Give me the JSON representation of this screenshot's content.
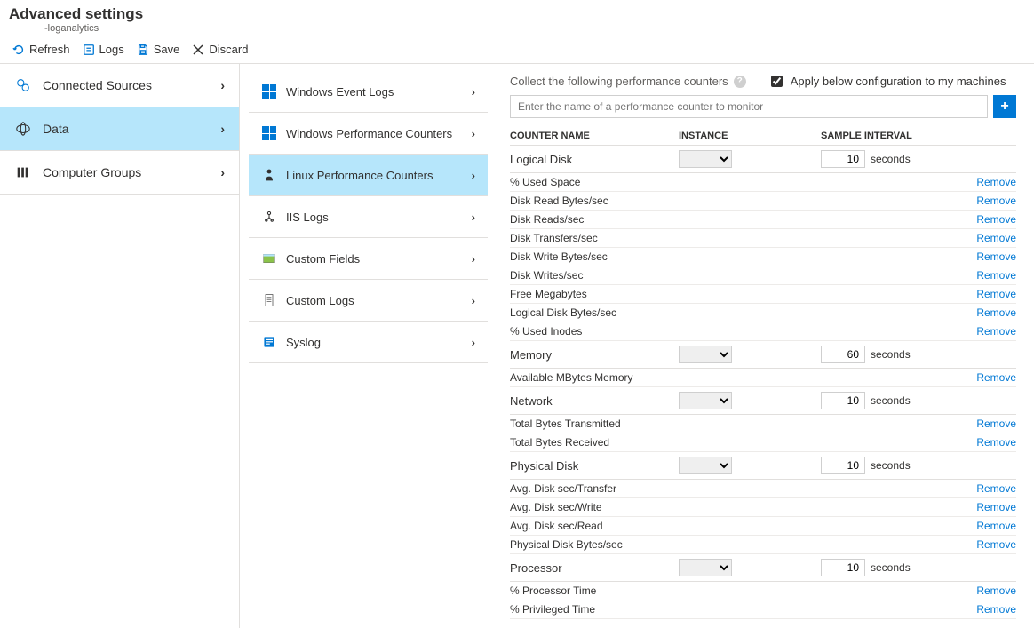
{
  "header": {
    "title": "Advanced settings",
    "subtitle": "-loganalytics"
  },
  "toolbar": {
    "refresh": "Refresh",
    "logs": "Logs",
    "save": "Save",
    "discard": "Discard"
  },
  "sidebar": [
    {
      "label": "Connected Sources",
      "selected": false
    },
    {
      "label": "Data",
      "selected": true
    },
    {
      "label": "Computer Groups",
      "selected": false
    }
  ],
  "dataItems": [
    {
      "label": "Windows Event Logs",
      "selected": false
    },
    {
      "label": "Windows Performance Counters",
      "selected": false
    },
    {
      "label": "Linux Performance Counters",
      "selected": true
    },
    {
      "label": "IIS Logs",
      "selected": false
    },
    {
      "label": "Custom Fields",
      "selected": false
    },
    {
      "label": "Custom Logs",
      "selected": false
    },
    {
      "label": "Syslog",
      "selected": false
    }
  ],
  "main": {
    "collectNote": "Collect the following performance counters",
    "applyLabel": "Apply below configuration to my machines",
    "applyChecked": true,
    "inputPlaceholder": "Enter the name of a performance counter to monitor",
    "headers": {
      "name": "COUNTER NAME",
      "instance": "INSTANCE",
      "interval": "SAMPLE INTERVAL"
    },
    "secondsLabel": "seconds",
    "removeLabel": "Remove",
    "groups": [
      {
        "name": "Logical Disk",
        "interval": "10",
        "counters": [
          "% Used Space",
          "Disk Read Bytes/sec",
          "Disk Reads/sec",
          "Disk Transfers/sec",
          "Disk Write Bytes/sec",
          "Disk Writes/sec",
          "Free Megabytes",
          "Logical Disk Bytes/sec",
          "% Used Inodes"
        ]
      },
      {
        "name": "Memory",
        "interval": "60",
        "counters": [
          "Available MBytes Memory"
        ]
      },
      {
        "name": "Network",
        "interval": "10",
        "counters": [
          "Total Bytes Transmitted",
          "Total Bytes Received"
        ]
      },
      {
        "name": "Physical Disk",
        "interval": "10",
        "counters": [
          "Avg. Disk sec/Transfer",
          "Avg. Disk sec/Write",
          "Avg. Disk sec/Read",
          "Physical Disk Bytes/sec"
        ]
      },
      {
        "name": "Processor",
        "interval": "10",
        "counters": [
          "% Processor Time",
          "% Privileged Time"
        ]
      }
    ]
  }
}
